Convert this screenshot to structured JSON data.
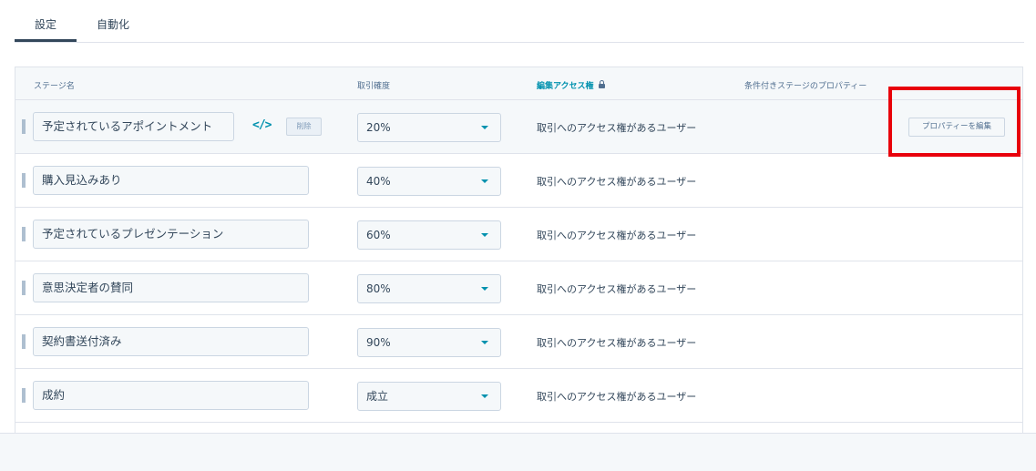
{
  "tabs": [
    {
      "label": "設定",
      "active": true
    },
    {
      "label": "自動化",
      "active": false
    }
  ],
  "table": {
    "headers": {
      "name": "ステージ名",
      "probability": "取引確度",
      "access": "編集アクセス権",
      "conditional": "条件付きステージのプロパティー"
    },
    "access_icon": "lock-icon",
    "rows": [
      {
        "name": "予定されているアポイントメント",
        "probability": "20%",
        "access": "取引へのアクセス権があるユーザー",
        "delete_label": "削除",
        "edit_props_label": "プロパティーを編集"
      },
      {
        "name": "購入見込みあり",
        "probability": "40%",
        "access": "取引へのアクセス権があるユーザー"
      },
      {
        "name": "予定されているプレゼンテーション",
        "probability": "60%",
        "access": "取引へのアクセス権があるユーザー"
      },
      {
        "name": "意思決定者の賛同",
        "probability": "80%",
        "access": "取引へのアクセス権があるユーザー"
      },
      {
        "name": "契約書送付済み",
        "probability": "90%",
        "access": "取引へのアクセス権があるユーザー"
      },
      {
        "name": "成約",
        "probability": "成立",
        "access": "取引へのアクセス権があるユーザー"
      }
    ]
  },
  "colors": {
    "accent": "#0091ae",
    "highlight": "#e8000b",
    "text": "#33475b",
    "border": "#cbd6e2",
    "background_alt": "#f5f8fa"
  }
}
